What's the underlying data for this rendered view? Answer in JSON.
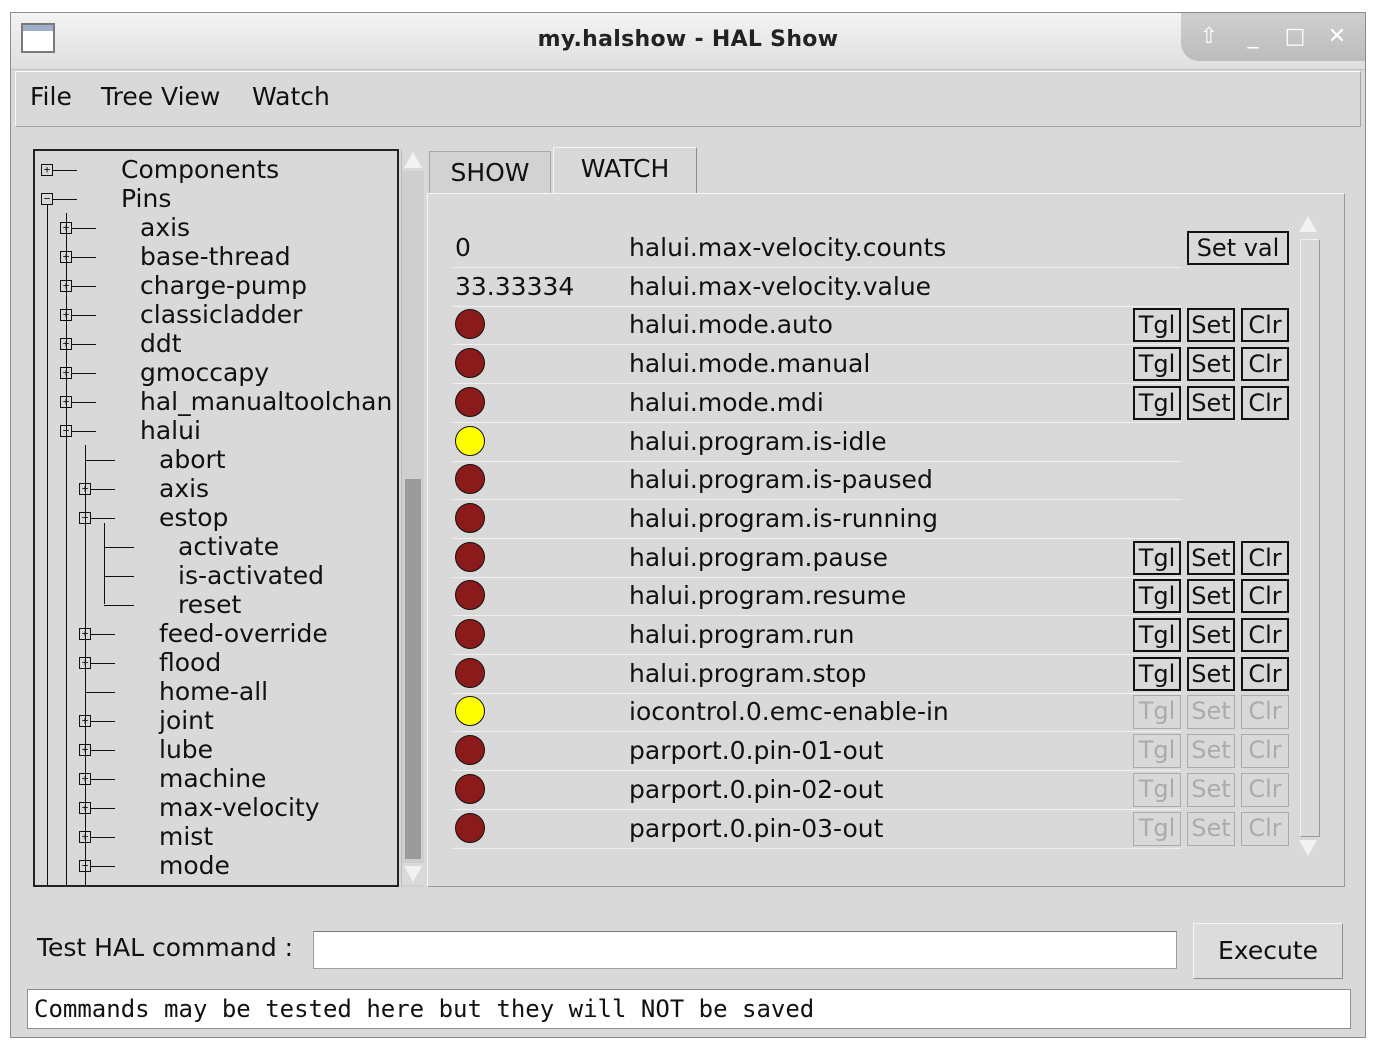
{
  "window": {
    "title": "my.halshow - HAL Show",
    "buttons": [
      "⇧",
      "_",
      "□",
      "✕"
    ]
  },
  "menu": [
    "File",
    "Tree View",
    "Watch"
  ],
  "tree": {
    "items": [
      {
        "label": "Components",
        "expander": "+"
      },
      {
        "label": "Pins",
        "expander": "−"
      },
      {
        "label": "axis",
        "expander": "+"
      },
      {
        "label": "base-thread",
        "expander": "+"
      },
      {
        "label": "charge-pump",
        "expander": "+"
      },
      {
        "label": "classicladder",
        "expander": "+"
      },
      {
        "label": "ddt",
        "expander": "+"
      },
      {
        "label": "gmoccapy",
        "expander": "+"
      },
      {
        "label": "hal_manualtoolchan",
        "expander": "+"
      },
      {
        "label": "halui",
        "expander": "−"
      },
      {
        "label": "abort",
        "expander": ""
      },
      {
        "label": "axis",
        "expander": "+"
      },
      {
        "label": "estop",
        "expander": "−"
      },
      {
        "label": "activate",
        "expander": ""
      },
      {
        "label": "is-activated",
        "expander": ""
      },
      {
        "label": "reset",
        "expander": ""
      },
      {
        "label": "feed-override",
        "expander": "+"
      },
      {
        "label": "flood",
        "expander": "+"
      },
      {
        "label": "home-all",
        "expander": ""
      },
      {
        "label": "joint",
        "expander": "+"
      },
      {
        "label": "lube",
        "expander": "+"
      },
      {
        "label": "machine",
        "expander": "+"
      },
      {
        "label": "max-velocity",
        "expander": "+"
      },
      {
        "label": "mist",
        "expander": "+"
      },
      {
        "label": "mode",
        "expander": "−"
      }
    ]
  },
  "tabs": {
    "show": "SHOW",
    "watch": "WATCH",
    "active": "WATCH"
  },
  "watch": {
    "rows": [
      {
        "value": "0",
        "pin": "halui.max-velocity.counts",
        "kind": "number",
        "buttons": [
          "Set val"
        ],
        "enabled": true
      },
      {
        "value": "33.33334",
        "pin": "halui.max-velocity.value",
        "kind": "number",
        "buttons": [],
        "enabled": true
      },
      {
        "value": "off",
        "pin": "halui.mode.auto",
        "kind": "bit",
        "buttons": [
          "Tgl",
          "Set",
          "Clr"
        ],
        "enabled": true
      },
      {
        "value": "off",
        "pin": "halui.mode.manual",
        "kind": "bit",
        "buttons": [
          "Tgl",
          "Set",
          "Clr"
        ],
        "enabled": true
      },
      {
        "value": "off",
        "pin": "halui.mode.mdi",
        "kind": "bit",
        "buttons": [
          "Tgl",
          "Set",
          "Clr"
        ],
        "enabled": true
      },
      {
        "value": "on",
        "pin": "halui.program.is-idle",
        "kind": "bit",
        "buttons": [],
        "enabled": true
      },
      {
        "value": "off",
        "pin": "halui.program.is-paused",
        "kind": "bit",
        "buttons": [],
        "enabled": true
      },
      {
        "value": "off",
        "pin": "halui.program.is-running",
        "kind": "bit",
        "buttons": [],
        "enabled": true
      },
      {
        "value": "off",
        "pin": "halui.program.pause",
        "kind": "bit",
        "buttons": [
          "Tgl",
          "Set",
          "Clr"
        ],
        "enabled": true
      },
      {
        "value": "off",
        "pin": "halui.program.resume",
        "kind": "bit",
        "buttons": [
          "Tgl",
          "Set",
          "Clr"
        ],
        "enabled": true
      },
      {
        "value": "off",
        "pin": "halui.program.run",
        "kind": "bit",
        "buttons": [
          "Tgl",
          "Set",
          "Clr"
        ],
        "enabled": true
      },
      {
        "value": "off",
        "pin": "halui.program.stop",
        "kind": "bit",
        "buttons": [
          "Tgl",
          "Set",
          "Clr"
        ],
        "enabled": true
      },
      {
        "value": "on",
        "pin": "iocontrol.0.emc-enable-in",
        "kind": "bit",
        "buttons": [
          "Tgl",
          "Set",
          "Clr"
        ],
        "enabled": false
      },
      {
        "value": "off",
        "pin": "parport.0.pin-01-out",
        "kind": "bit",
        "buttons": [
          "Tgl",
          "Set",
          "Clr"
        ],
        "enabled": false
      },
      {
        "value": "off",
        "pin": "parport.0.pin-02-out",
        "kind": "bit",
        "buttons": [
          "Tgl",
          "Set",
          "Clr"
        ],
        "enabled": false
      },
      {
        "value": "off",
        "pin": "parport.0.pin-03-out",
        "kind": "bit",
        "buttons": [
          "Tgl",
          "Set",
          "Clr"
        ],
        "enabled": false
      }
    ],
    "led_colors": {
      "on": "#ffff00",
      "off": "#8b1a1a"
    }
  },
  "command": {
    "label": "Test HAL command :",
    "value": "",
    "execute_label": "Execute"
  },
  "status": {
    "text": "Commands may be tested here but they will NOT be saved"
  }
}
